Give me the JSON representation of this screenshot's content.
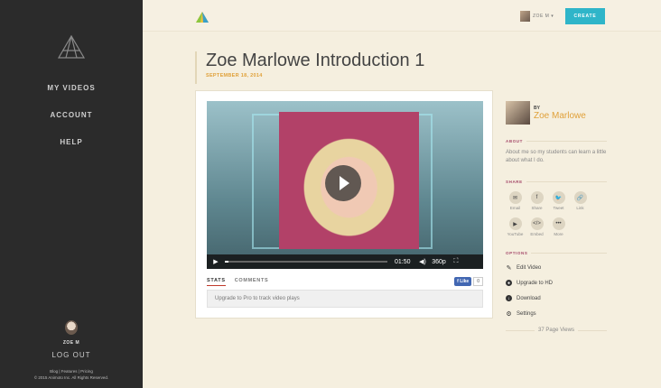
{
  "sidebar": {
    "nav": [
      "MY VIDEOS",
      "ACCOUNT",
      "HELP"
    ],
    "username": "ZOE M",
    "logout": "LOG OUT",
    "footer_links": "Blog | Features | Pricing",
    "copyright": "© 2015 Animoto Inc. All Rights Reserved."
  },
  "topbar": {
    "user_label": "ZOE M ▾",
    "create_label": "CREATE"
  },
  "video": {
    "title": "Zoe Marlowe Introduction 1",
    "date": "SEPTEMBER 18, 2014",
    "time": "01:50",
    "quality": "360p",
    "progress_fraction": 0.02
  },
  "tabs": [
    "STATS",
    "COMMENTS"
  ],
  "like": {
    "label": "f Like",
    "count": "0"
  },
  "upgrade_text": "Upgrade to Pro to track video plays",
  "author": {
    "by": "BY",
    "name": "Zoe Marlowe"
  },
  "sections": {
    "about": "ABOUT",
    "share": "SHARE",
    "options": "OPTIONS"
  },
  "about_text": "About me so my students can learn a little about what I do.",
  "share": [
    {
      "label": "Email",
      "glyph": "✉"
    },
    {
      "label": "Share",
      "glyph": "f"
    },
    {
      "label": "Tweet",
      "glyph": "🐦"
    },
    {
      "label": "Link",
      "glyph": "🔗"
    },
    {
      "label": "YouTube",
      "glyph": "▶"
    },
    {
      "label": "Embed",
      "glyph": "</>"
    },
    {
      "label": "More",
      "glyph": "•••"
    }
  ],
  "options": [
    {
      "label": "Edit Video",
      "icon": "pencil-icon"
    },
    {
      "label": "Upgrade to HD",
      "icon": "hd-icon"
    },
    {
      "label": "Download",
      "icon": "download-icon"
    },
    {
      "label": "Settings",
      "icon": "gear-icon"
    }
  ],
  "page_views": "37 Page Views"
}
